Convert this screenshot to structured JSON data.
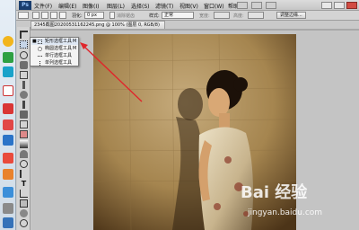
{
  "menubar": {
    "logo": "Ps",
    "items": [
      "文件(F)",
      "编辑(E)",
      "图像(I)",
      "图层(L)",
      "选择(S)",
      "滤镜(T)",
      "视图(V)",
      "窗口(W)",
      "帮助(H)"
    ]
  },
  "options": {
    "feather_label": "羽化:",
    "feather_value": "0 px",
    "antialias_label": "消除锯齿",
    "style_label": "样式:",
    "style_value": "正常",
    "width_label": "宽度:",
    "height_label": "高度:",
    "refine_edge_label": "调整边缘..."
  },
  "document": {
    "tab_title": "2345截图20200531162245.png @ 100% (图层 0, RGB/8)"
  },
  "flyout": {
    "items": [
      {
        "label": "矩形选框工具",
        "key": "M"
      },
      {
        "label": "椭圆选框工具",
        "key": "M"
      },
      {
        "label": "单行选框工具",
        "key": ""
      },
      {
        "label": "单列选框工具",
        "key": ""
      }
    ]
  },
  "watermark": {
    "logo": "Bai 经验",
    "url": "jingyan.baidu.com"
  },
  "colors": {
    "annotation_arrow": "#e0262b",
    "photo_wall": "#b89a6a"
  }
}
